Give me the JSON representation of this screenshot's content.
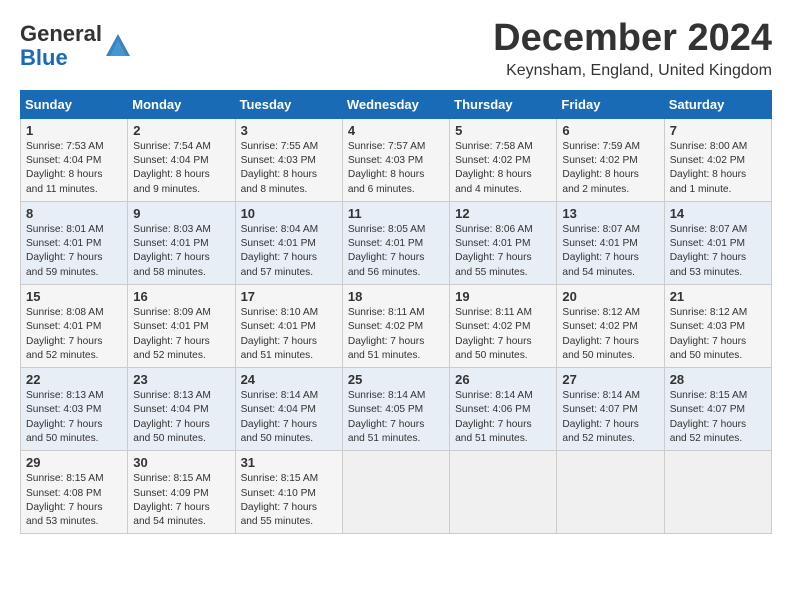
{
  "logo": {
    "line1": "General",
    "line2": "Blue"
  },
  "header": {
    "month": "December 2024",
    "location": "Keynsham, England, United Kingdom"
  },
  "weekdays": [
    "Sunday",
    "Monday",
    "Tuesday",
    "Wednesday",
    "Thursday",
    "Friday",
    "Saturday"
  ],
  "weeks": [
    [
      {
        "day": "1",
        "info": "Sunrise: 7:53 AM\nSunset: 4:04 PM\nDaylight: 8 hours\nand 11 minutes."
      },
      {
        "day": "2",
        "info": "Sunrise: 7:54 AM\nSunset: 4:04 PM\nDaylight: 8 hours\nand 9 minutes."
      },
      {
        "day": "3",
        "info": "Sunrise: 7:55 AM\nSunset: 4:03 PM\nDaylight: 8 hours\nand 8 minutes."
      },
      {
        "day": "4",
        "info": "Sunrise: 7:57 AM\nSunset: 4:03 PM\nDaylight: 8 hours\nand 6 minutes."
      },
      {
        "day": "5",
        "info": "Sunrise: 7:58 AM\nSunset: 4:02 PM\nDaylight: 8 hours\nand 4 minutes."
      },
      {
        "day": "6",
        "info": "Sunrise: 7:59 AM\nSunset: 4:02 PM\nDaylight: 8 hours\nand 2 minutes."
      },
      {
        "day": "7",
        "info": "Sunrise: 8:00 AM\nSunset: 4:02 PM\nDaylight: 8 hours\nand 1 minute."
      }
    ],
    [
      {
        "day": "8",
        "info": "Sunrise: 8:01 AM\nSunset: 4:01 PM\nDaylight: 7 hours\nand 59 minutes."
      },
      {
        "day": "9",
        "info": "Sunrise: 8:03 AM\nSunset: 4:01 PM\nDaylight: 7 hours\nand 58 minutes."
      },
      {
        "day": "10",
        "info": "Sunrise: 8:04 AM\nSunset: 4:01 PM\nDaylight: 7 hours\nand 57 minutes."
      },
      {
        "day": "11",
        "info": "Sunrise: 8:05 AM\nSunset: 4:01 PM\nDaylight: 7 hours\nand 56 minutes."
      },
      {
        "day": "12",
        "info": "Sunrise: 8:06 AM\nSunset: 4:01 PM\nDaylight: 7 hours\nand 55 minutes."
      },
      {
        "day": "13",
        "info": "Sunrise: 8:07 AM\nSunset: 4:01 PM\nDaylight: 7 hours\nand 54 minutes."
      },
      {
        "day": "14",
        "info": "Sunrise: 8:07 AM\nSunset: 4:01 PM\nDaylight: 7 hours\nand 53 minutes."
      }
    ],
    [
      {
        "day": "15",
        "info": "Sunrise: 8:08 AM\nSunset: 4:01 PM\nDaylight: 7 hours\nand 52 minutes."
      },
      {
        "day": "16",
        "info": "Sunrise: 8:09 AM\nSunset: 4:01 PM\nDaylight: 7 hours\nand 52 minutes."
      },
      {
        "day": "17",
        "info": "Sunrise: 8:10 AM\nSunset: 4:01 PM\nDaylight: 7 hours\nand 51 minutes."
      },
      {
        "day": "18",
        "info": "Sunrise: 8:11 AM\nSunset: 4:02 PM\nDaylight: 7 hours\nand 51 minutes."
      },
      {
        "day": "19",
        "info": "Sunrise: 8:11 AM\nSunset: 4:02 PM\nDaylight: 7 hours\nand 50 minutes."
      },
      {
        "day": "20",
        "info": "Sunrise: 8:12 AM\nSunset: 4:02 PM\nDaylight: 7 hours\nand 50 minutes."
      },
      {
        "day": "21",
        "info": "Sunrise: 8:12 AM\nSunset: 4:03 PM\nDaylight: 7 hours\nand 50 minutes."
      }
    ],
    [
      {
        "day": "22",
        "info": "Sunrise: 8:13 AM\nSunset: 4:03 PM\nDaylight: 7 hours\nand 50 minutes."
      },
      {
        "day": "23",
        "info": "Sunrise: 8:13 AM\nSunset: 4:04 PM\nDaylight: 7 hours\nand 50 minutes."
      },
      {
        "day": "24",
        "info": "Sunrise: 8:14 AM\nSunset: 4:04 PM\nDaylight: 7 hours\nand 50 minutes."
      },
      {
        "day": "25",
        "info": "Sunrise: 8:14 AM\nSunset: 4:05 PM\nDaylight: 7 hours\nand 51 minutes."
      },
      {
        "day": "26",
        "info": "Sunrise: 8:14 AM\nSunset: 4:06 PM\nDaylight: 7 hours\nand 51 minutes."
      },
      {
        "day": "27",
        "info": "Sunrise: 8:14 AM\nSunset: 4:07 PM\nDaylight: 7 hours\nand 52 minutes."
      },
      {
        "day": "28",
        "info": "Sunrise: 8:15 AM\nSunset: 4:07 PM\nDaylight: 7 hours\nand 52 minutes."
      }
    ],
    [
      {
        "day": "29",
        "info": "Sunrise: 8:15 AM\nSunset: 4:08 PM\nDaylight: 7 hours\nand 53 minutes."
      },
      {
        "day": "30",
        "info": "Sunrise: 8:15 AM\nSunset: 4:09 PM\nDaylight: 7 hours\nand 54 minutes."
      },
      {
        "day": "31",
        "info": "Sunrise: 8:15 AM\nSunset: 4:10 PM\nDaylight: 7 hours\nand 55 minutes."
      },
      {
        "day": "",
        "info": ""
      },
      {
        "day": "",
        "info": ""
      },
      {
        "day": "",
        "info": ""
      },
      {
        "day": "",
        "info": ""
      }
    ]
  ]
}
